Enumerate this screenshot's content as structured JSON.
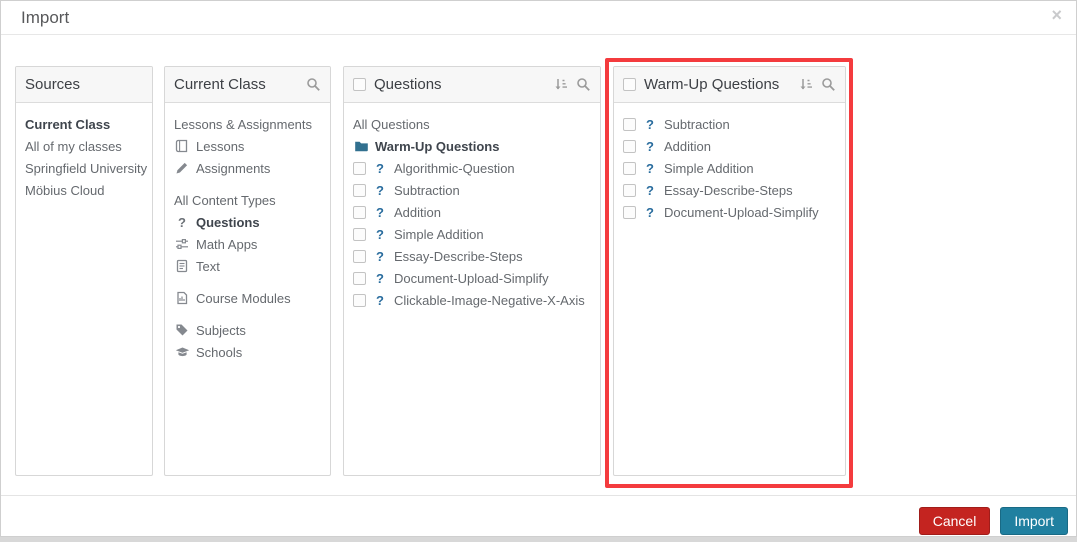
{
  "dialog": {
    "title": "Import",
    "close_icon": "×"
  },
  "colors": {
    "highlight_red": "#f43b3e",
    "cancel_red": "#c42420",
    "import_teal": "#2080a0",
    "question_blue": "#2a6d9e",
    "folder_blue": "#31708f"
  },
  "sources": {
    "title": "Sources",
    "items": [
      {
        "label": "Current Class",
        "bold": true
      },
      {
        "label": "All of my classes"
      },
      {
        "label": "Springfield University"
      },
      {
        "label": "Möbius Cloud"
      }
    ]
  },
  "current_class": {
    "title": "Current Class",
    "header_icons": [
      "search-icon"
    ],
    "items": [
      {
        "label": "Lessons & Assignments",
        "type": "plain"
      },
      {
        "label": "Lessons",
        "icon": "book-icon"
      },
      {
        "label": "Assignments",
        "icon": "pencil-icon"
      },
      {
        "type": "spacer"
      },
      {
        "label": "All Content Types",
        "type": "plain"
      },
      {
        "label": "Questions",
        "icon": "question-icon",
        "bold": true
      },
      {
        "label": "Math Apps",
        "icon": "sliders-icon"
      },
      {
        "label": "Text",
        "icon": "text-file-icon"
      },
      {
        "type": "spacer"
      },
      {
        "label": "Course Modules",
        "icon": "course-module-icon"
      },
      {
        "type": "spacer"
      },
      {
        "label": "Subjects",
        "icon": "tag-icon"
      },
      {
        "label": "Schools",
        "icon": "graduation-cap-icon"
      }
    ]
  },
  "questions": {
    "title": "Questions",
    "header_icons": [
      "sort-icon",
      "search-icon"
    ],
    "has_select_all_checkbox": true,
    "items": [
      {
        "label": "All Questions",
        "type": "plain"
      },
      {
        "label": "Warm-Up Questions",
        "icon": "folder-icon",
        "bold": true
      },
      {
        "label": "Algorithmic-Question",
        "checkbox": true,
        "icon": "question-icon-blue"
      },
      {
        "label": "Subtraction",
        "checkbox": true,
        "icon": "question-icon-blue"
      },
      {
        "label": "Addition",
        "checkbox": true,
        "icon": "question-icon-blue"
      },
      {
        "label": "Simple Addition",
        "checkbox": true,
        "icon": "question-icon-blue"
      },
      {
        "label": "Essay-Describe-Steps",
        "checkbox": true,
        "icon": "question-icon-blue"
      },
      {
        "label": "Document-Upload-Simplify",
        "checkbox": true,
        "icon": "question-icon-blue"
      },
      {
        "label": "Clickable-Image-Negative-X-Axis",
        "checkbox": true,
        "icon": "question-icon-blue"
      }
    ]
  },
  "warmup": {
    "title": "Warm-Up Questions",
    "header_icons": [
      "sort-icon",
      "search-icon"
    ],
    "has_select_all_checkbox": true,
    "highlighted": true,
    "items": [
      {
        "label": "Subtraction",
        "checkbox": true,
        "icon": "question-icon-blue"
      },
      {
        "label": "Addition",
        "checkbox": true,
        "icon": "question-icon-blue"
      },
      {
        "label": "Simple Addition",
        "checkbox": true,
        "icon": "question-icon-blue"
      },
      {
        "label": "Essay-Describe-Steps",
        "checkbox": true,
        "icon": "question-icon-blue"
      },
      {
        "label": "Document-Upload-Simplify",
        "checkbox": true,
        "icon": "question-icon-blue"
      }
    ]
  },
  "footer": {
    "cancel_label": "Cancel",
    "import_label": "Import"
  }
}
